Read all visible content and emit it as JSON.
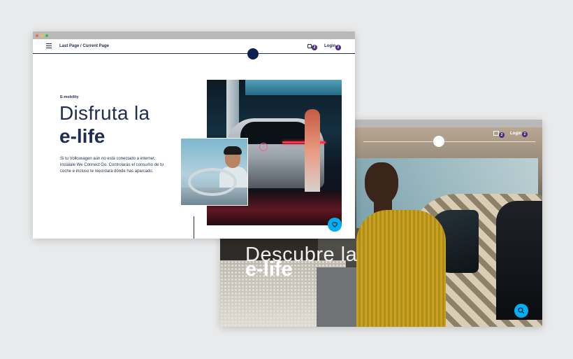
{
  "colors": {
    "brand_dark": "#1f2c53",
    "nav_circle": "#0c2152",
    "accent_button": "#00b0f0",
    "badge": "#4a2d7e",
    "traffic_red": "#ff5f57",
    "traffic_yellow": "#febc2e",
    "traffic_green": "#28c840"
  },
  "front_window": {
    "header": {
      "breadcrumb": "Last Page / Current Page",
      "cart_count": "2",
      "login_label": "Login",
      "login_count": "2"
    },
    "eyebrow": "E-mobility",
    "title_light": "Disfruta la",
    "title_bold": "e-life",
    "body": "Si tu Volkswagen aún no está conectado a internet, instálale We Connect Go. Controlarás el consumo de tu coche e incluso te recordará dónde has aparcado.",
    "icons": {
      "menu": "hamburger-icon",
      "cart": "cart-icon",
      "favorite": "heart-icon"
    }
  },
  "back_window": {
    "header": {
      "cart_count": "2",
      "login_label": "Login",
      "login_count": "2"
    },
    "hero_light": "Descubre la",
    "hero_bold": "e-life",
    "icons": {
      "cart": "cart-icon",
      "search": "search-icon"
    }
  }
}
